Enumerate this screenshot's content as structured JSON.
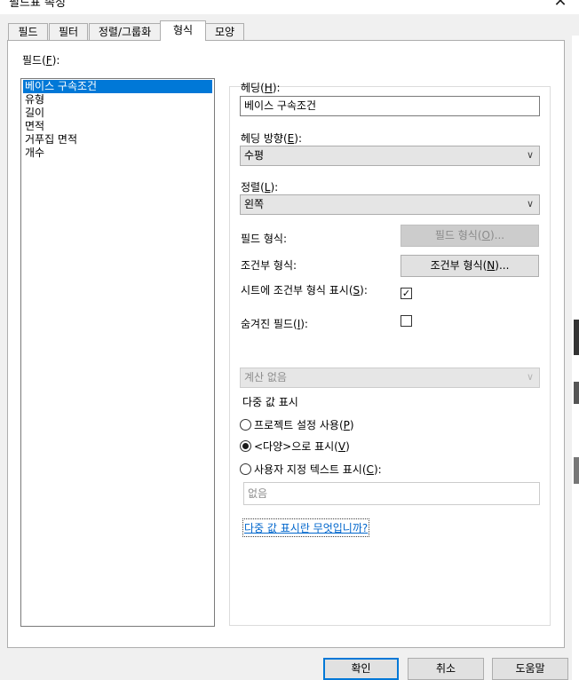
{
  "window": {
    "title": "필드표 속성",
    "close_glyph": "✕"
  },
  "tabs": [
    {
      "label": "필드"
    },
    {
      "label": "필터"
    },
    {
      "label": "정렬/그룹화"
    },
    {
      "label": "형식"
    },
    {
      "label": "모양"
    }
  ],
  "fields": {
    "label": "필드",
    "label_key": "F",
    "items": [
      "베이스 구속조건",
      "유형",
      "길이",
      "면적",
      "거푸집 면적",
      "개수"
    ]
  },
  "format": {
    "heading_label": "헤딩",
    "heading_key": "H",
    "heading_value": "베이스 구속조건",
    "heading_orientation_label": "헤딩 방향",
    "heading_orientation_key": "E",
    "heading_orientation_value": "수평",
    "alignment_label": "정렬",
    "alignment_key": "L",
    "alignment_value": "왼쪽",
    "field_format_label": "필드 형식:",
    "field_format_button": "필드 형식",
    "field_format_button_key": "O",
    "conditional_format_label": "조건부 형식:",
    "conditional_format_button": "조건부 형식",
    "conditional_format_button_key": "N",
    "show_conditional_label": "시트에 조건부 형식 표시",
    "show_conditional_key": "S",
    "show_conditional_checked": true,
    "hidden_field_label": "숨겨진 필드",
    "hidden_field_key": "I",
    "hidden_field_checked": false,
    "calculation_value": "계산 없음",
    "multi_value_label": "다중 값 표시",
    "radio_project_label": "프로젝트 설정 사용",
    "radio_project_key": "P",
    "radio_varies_label": "<다양>으로 표시",
    "radio_varies_key": "V",
    "radio_custom_label": "사용자 지정 텍스트 표시",
    "radio_custom_key": "C",
    "selected_radio": "varies",
    "custom_text_placeholder": "없음",
    "help_link": "다중 값 표시란 무엇입니까?"
  },
  "buttons": {
    "ok": "확인",
    "cancel": "취소",
    "help": "도움말"
  },
  "colors": {
    "selection": "#0078d7",
    "link": "#0066cc",
    "default_button_border": "#0078d7"
  }
}
